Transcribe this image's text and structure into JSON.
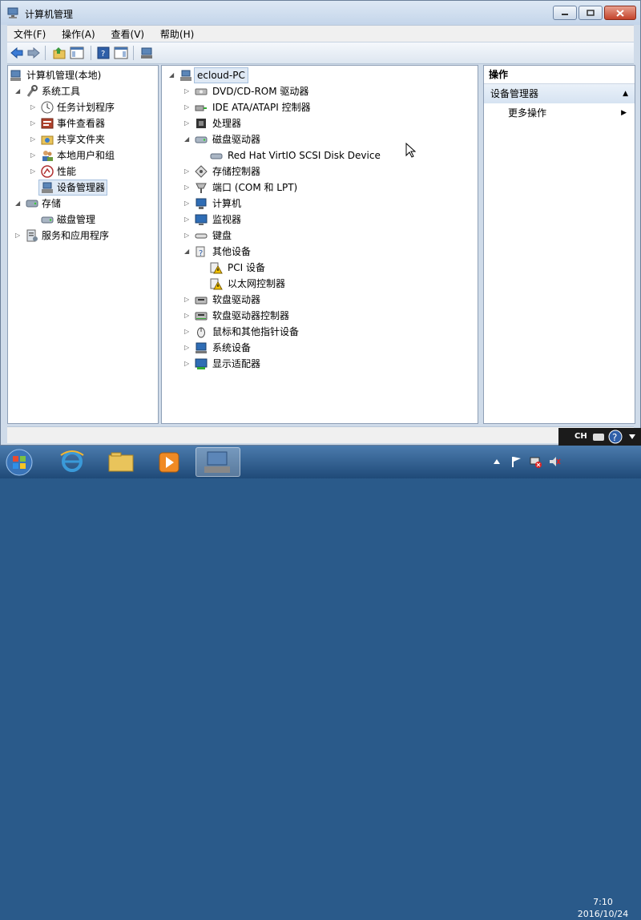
{
  "window": {
    "title": "计算机管理",
    "buttons": [
      "minimize",
      "maximize",
      "close"
    ]
  },
  "menu": [
    "文件(F)",
    "操作(A)",
    "查看(V)",
    "帮助(H)"
  ],
  "left_tree": {
    "root": "计算机管理(本地)",
    "items": [
      {
        "label": "系统工具",
        "level": 1,
        "expanded": true
      },
      {
        "label": "任务计划程序",
        "level": 2
      },
      {
        "label": "事件查看器",
        "level": 2
      },
      {
        "label": "共享文件夹",
        "level": 2
      },
      {
        "label": "本地用户和组",
        "level": 2
      },
      {
        "label": "性能",
        "level": 2
      },
      {
        "label": "设备管理器",
        "level": 2,
        "selected": true
      },
      {
        "label": "存储",
        "level": 1,
        "expanded": true
      },
      {
        "label": "磁盘管理",
        "level": 2
      },
      {
        "label": "服务和应用程序",
        "level": 1
      }
    ]
  },
  "device_tree": {
    "root": "ecloud-PC",
    "items": [
      {
        "label": "DVD/CD-ROM 驱动器",
        "icon": "dvd-drive-icon"
      },
      {
        "label": "IDE ATA/ATAPI 控制器",
        "icon": "ide-controller-icon"
      },
      {
        "label": "处理器",
        "icon": "processor-icon"
      },
      {
        "label": "磁盘驱动器",
        "icon": "disk-drive-icon",
        "expanded": true
      },
      {
        "label": "Red Hat VirtIO SCSI Disk Device",
        "icon": "disk-device-icon",
        "child": true
      },
      {
        "label": "存储控制器",
        "icon": "storage-controller-icon"
      },
      {
        "label": "端口 (COM 和 LPT)",
        "icon": "port-icon"
      },
      {
        "label": "计算机",
        "icon": "computer-icon"
      },
      {
        "label": "监视器",
        "icon": "monitor-icon"
      },
      {
        "label": "键盘",
        "icon": "keyboard-icon"
      },
      {
        "label": "其他设备",
        "icon": "unknown-device-icon",
        "expanded": true
      },
      {
        "label": "PCI 设备",
        "icon": "warning-device-icon",
        "child": true
      },
      {
        "label": "以太网控制器",
        "icon": "warning-device-icon",
        "child": true
      },
      {
        "label": "软盘驱动器",
        "icon": "floppy-drive-icon"
      },
      {
        "label": "软盘驱动器控制器",
        "icon": "floppy-controller-icon"
      },
      {
        "label": "鼠标和其他指针设备",
        "icon": "mouse-icon"
      },
      {
        "label": "系统设备",
        "icon": "system-device-icon"
      },
      {
        "label": "显示适配器",
        "icon": "display-adapter-icon"
      }
    ]
  },
  "actions": {
    "title": "操作",
    "section": "设备管理器",
    "more": "更多操作"
  },
  "language_bar": {
    "lang": "CH"
  },
  "clock": {
    "time": "7:10",
    "date": "2016/10/24"
  },
  "colors": {
    "titlebar": "#c4d5ea",
    "selection": "#dfe9f5",
    "taskbar": "#1f4a78",
    "warning": "#f2c200"
  }
}
